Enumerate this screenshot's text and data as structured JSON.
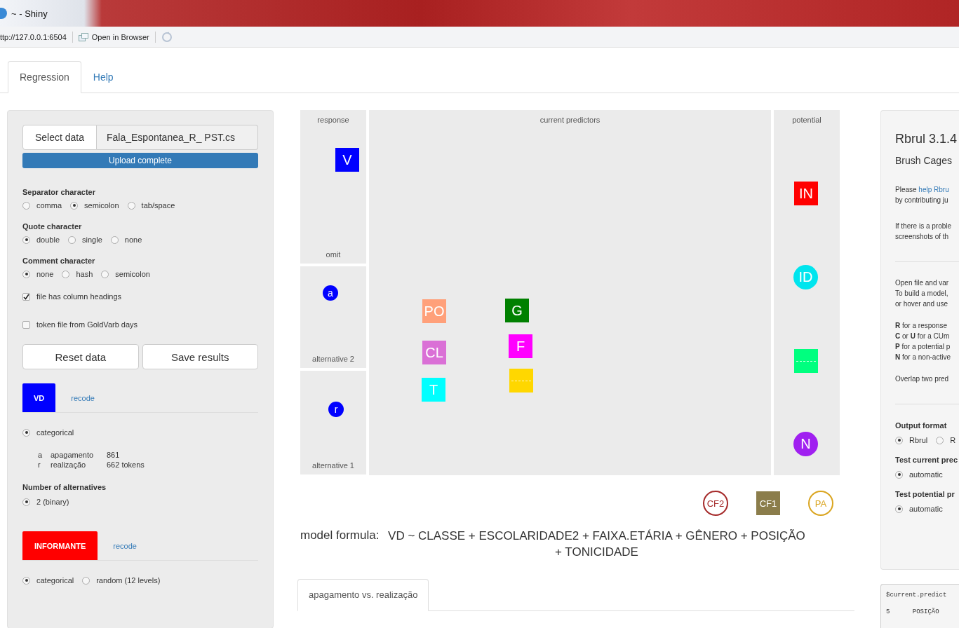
{
  "window": {
    "title": "~ - Shiny"
  },
  "address_bar": {
    "url": "ttp://127.0.0.1:6504",
    "open_button": "Open in Browser"
  },
  "tabs": [
    {
      "label": "Regression",
      "selected": true
    },
    {
      "label": "Help",
      "selected": false
    }
  ],
  "sidebar": {
    "file": {
      "button": "Select data",
      "filename": "Fala_Espontanea_R_ PST.cs",
      "progress": {
        "label": "Upload complete",
        "level": 1
      }
    },
    "radio_groups": [
      {
        "label": "Separator character",
        "options": [
          {
            "label": "comma",
            "selected": false
          },
          {
            "label": "semicolon",
            "selected": true
          },
          {
            "label": "tab/space",
            "selected": false
          }
        ]
      },
      {
        "label": "Quote character",
        "options": [
          {
            "label": "double",
            "selected": true
          },
          {
            "label": "single",
            "selected": false
          },
          {
            "label": "none",
            "selected": false
          }
        ]
      },
      {
        "label": "Comment character",
        "options": [
          {
            "label": "none",
            "selected": true
          },
          {
            "label": "hash",
            "selected": false
          },
          {
            "label": "semicolon",
            "selected": false
          }
        ]
      }
    ],
    "checkboxes": [
      {
        "label": "file has column headings",
        "checked": true
      },
      {
        "label": "token file from GoldVarb days",
        "checked": false
      }
    ],
    "buttons": [
      "Reset data",
      "Save results"
    ],
    "variables": [
      {
        "name": "VD",
        "color": "#0000ff",
        "recode": "recode",
        "type_options": [
          {
            "label": "categorical",
            "selected": true
          }
        ],
        "levels": [
          {
            "code": "a",
            "label": "apagamento",
            "count": "861"
          },
          {
            "code": "r",
            "label": "realização",
            "count": "662 tokens"
          }
        ],
        "alternatives": {
          "label": "Number of alternatives",
          "options": [
            {
              "label": "2 (binary)",
              "selected": true
            }
          ]
        }
      },
      {
        "name": "INFORMANTE",
        "color": "#ff0000",
        "recode": "recode",
        "type_options": [
          {
            "label": "categorical",
            "selected": true
          },
          {
            "label": "random (12 levels)",
            "selected": false
          }
        ]
      }
    ]
  },
  "canvas": {
    "regions": [
      {
        "header": "response",
        "footer": "omit"
      },
      {
        "footer": "alternative 2"
      },
      {
        "footer": "alternative 1"
      },
      {
        "header": "current predictors"
      },
      {
        "header": "potential"
      }
    ],
    "nodes": [
      {
        "label": "V",
        "kind": "square",
        "color": "#0000ff"
      },
      {
        "label": "a",
        "kind": "dot",
        "color": "#0000ff"
      },
      {
        "label": "r",
        "kind": "dot",
        "color": "#0000ff"
      },
      {
        "label": "PO",
        "kind": "square",
        "color": "#ffa07a"
      },
      {
        "label": "G",
        "kind": "square",
        "color": "#008000"
      },
      {
        "label": "CL",
        "kind": "square",
        "color": "#da70d6"
      },
      {
        "label": "F",
        "kind": "square",
        "color": "#ff00ff"
      },
      {
        "label": "T",
        "kind": "square",
        "color": "#00ffff"
      },
      {
        "kind": "square",
        "color": "#ffd700"
      },
      {
        "label": "IN",
        "kind": "square",
        "color": "#ff0000"
      },
      {
        "label": "ID",
        "kind": "circle",
        "color": "#00e5ee"
      },
      {
        "kind": "square",
        "color": "#00ff7f"
      },
      {
        "label": "N",
        "kind": "circle",
        "color": "#a020f0"
      }
    ],
    "extra_nodes": [
      {
        "label": "CF2",
        "kind": "ring",
        "color": "#a52a2a"
      },
      {
        "label": "CF1",
        "kind": "square",
        "color": "#8b7d4b"
      },
      {
        "label": "PA",
        "kind": "ring",
        "color": "#daa520"
      }
    ]
  },
  "model_formula": {
    "label": "model formula:",
    "formula": "VD ~ CLASSE + ESCOLARIDADE2 + FAIXA.ETÁRIA + GÊNERO + POSIÇÃO + TONICIDADE"
  },
  "result_tabs": [
    {
      "label": "apagamento vs. realização",
      "selected": true
    }
  ],
  "info_panel": {
    "title": "Rbrul 3.1.4",
    "subtitle": "Brush Cages",
    "help": {
      "before": "Please ",
      "link": "help Rbru"
    },
    "paragraphs": [
      [
        "by contributing ju"
      ],
      [
        "If there is a proble",
        "screenshots of th"
      ],
      [
        "Open file and var",
        "To build a model,",
        "or hover and use"
      ],
      [
        "**R** for a response",
        "**C** or **U** for a CUm",
        "**P** for a potential p",
        "**N** for a non-active"
      ],
      [
        "Overlap two pred"
      ]
    ],
    "radio_groups": [
      {
        "label": "Output format",
        "options": [
          {
            "label": "Rbrul",
            "selected": true
          },
          {
            "label": "R",
            "selected": false
          }
        ]
      },
      {
        "label": "Test current prec",
        "options": [
          {
            "label": "automatic",
            "selected": true
          }
        ]
      },
      {
        "label": "Test potential pr",
        "options": [
          {
            "label": "automatic",
            "selected": true
          }
        ]
      }
    ]
  },
  "output": {
    "lines": [
      "$current.predict",
      "5      POSIÇÃO"
    ]
  }
}
